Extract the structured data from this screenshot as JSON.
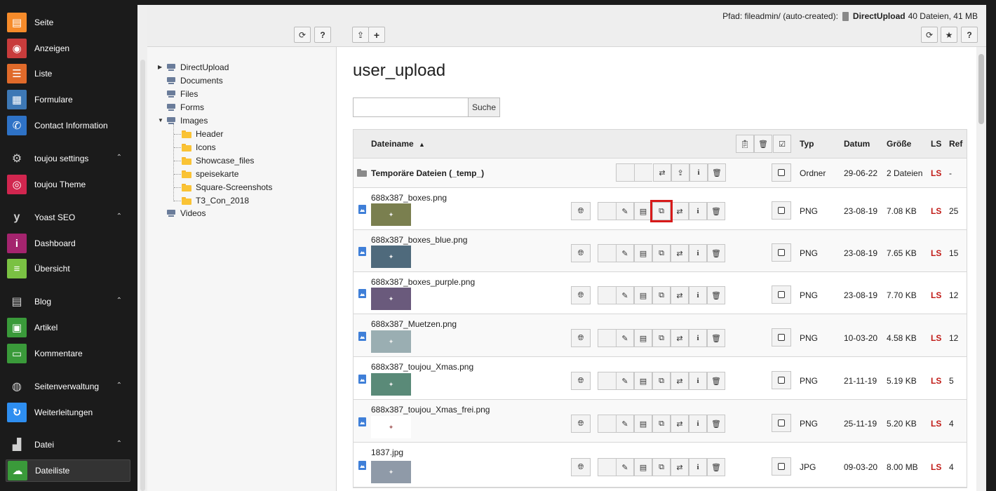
{
  "module_menu": [
    {
      "label": "Seite",
      "icon": "page-icon",
      "glyph": "▤",
      "color": "#f68b2a",
      "group": false
    },
    {
      "label": "Anzeigen",
      "icon": "eye-icon",
      "glyph": "◉",
      "color": "#c83c3c",
      "group": false
    },
    {
      "label": "Liste",
      "icon": "list-icon",
      "glyph": "☰",
      "color": "#e06a2a",
      "group": false
    },
    {
      "label": "Formulare",
      "icon": "form-icon",
      "glyph": "▦",
      "color": "#3d78b5",
      "group": false
    },
    {
      "label": "Contact Information",
      "icon": "contact-icon",
      "glyph": "✆",
      "color": "#2e72c6",
      "group": false
    },
    {
      "label": "toujou settings",
      "icon": "gear-icon",
      "glyph": "⚙",
      "color": "transparent",
      "group": true
    },
    {
      "label": "toujou Theme",
      "icon": "fingerprint-icon",
      "glyph": "◎",
      "color": "#d1264f",
      "group": false
    },
    {
      "label": "Yoast SEO",
      "icon": "yoast-icon",
      "glyph": "y",
      "color": "transparent",
      "group": true
    },
    {
      "label": "Dashboard",
      "icon": "info-icon",
      "glyph": "i",
      "color": "#a4246e",
      "group": false
    },
    {
      "label": "Übersicht",
      "icon": "overview-icon",
      "glyph": "≡",
      "color": "#7ac143",
      "group": false
    },
    {
      "label": "Blog",
      "icon": "blog-icon",
      "glyph": "▤",
      "color": "transparent",
      "group": true
    },
    {
      "label": "Artikel",
      "icon": "article-icon",
      "glyph": "▣",
      "color": "#3a9a3a",
      "group": false
    },
    {
      "label": "Kommentare",
      "icon": "comment-icon",
      "glyph": "▭",
      "color": "#3a9a3a",
      "group": false
    },
    {
      "label": "Seitenverwaltung",
      "icon": "globe-icon",
      "glyph": "◍",
      "color": "transparent",
      "group": true
    },
    {
      "label": "Weiterleitungen",
      "icon": "redirect-icon",
      "glyph": "↻",
      "color": "#2e8ef0",
      "group": false
    },
    {
      "label": "Datei",
      "icon": "file-group-icon",
      "glyph": "▟",
      "color": "transparent",
      "group": true
    },
    {
      "label": "Dateiliste",
      "icon": "filelist-icon",
      "glyph": "☁",
      "color": "#3a9a3a",
      "group": false
    }
  ],
  "path": {
    "prefix": "Pfad: fileadmin/ (auto-created):",
    "storage": "DirectUpload",
    "info": "40 Dateien, 41 MB"
  },
  "tree": {
    "nodes": [
      "DirectUpload",
      "Documents",
      "Files",
      "Forms",
      "Images",
      "Videos"
    ],
    "folders": [
      "Header",
      "Icons",
      "Showcase_files",
      "speisekarte",
      "Square-Screenshots",
      "T3_Con_2018"
    ]
  },
  "page_title": "user_upload",
  "search": {
    "button": "Suche",
    "value": ""
  },
  "table": {
    "headers": {
      "name": "Dateiname",
      "type": "Typ",
      "date": "Datum",
      "size": "Größe",
      "ls": "LS",
      "ref": "Ref"
    },
    "temp_row": {
      "name": "Temporäre Dateien (_temp_)",
      "type": "Ordner",
      "date": "29-06-22",
      "size": "2 Dateien",
      "ls": "LS",
      "ref": "-"
    },
    "files": [
      {
        "name": "688x387_boxes.png",
        "type": "PNG",
        "date": "23-08-19",
        "size": "7.08 KB",
        "ls": "LS",
        "ref": "25",
        "thumb": "#7a7f4f"
      },
      {
        "name": "688x387_boxes_blue.png",
        "type": "PNG",
        "date": "23-08-19",
        "size": "7.65 KB",
        "ls": "LS",
        "ref": "15",
        "thumb": "#4f6a7c"
      },
      {
        "name": "688x387_boxes_purple.png",
        "type": "PNG",
        "date": "23-08-19",
        "size": "7.70 KB",
        "ls": "LS",
        "ref": "12",
        "thumb": "#6a5a7c"
      },
      {
        "name": "688x387_Muetzen.png",
        "type": "PNG",
        "date": "10-03-20",
        "size": "4.58 KB",
        "ls": "LS",
        "ref": "12",
        "thumb": "#9aaeb2"
      },
      {
        "name": "688x387_toujou_Xmas.png",
        "type": "PNG",
        "date": "21-11-19",
        "size": "5.19 KB",
        "ls": "LS",
        "ref": "5",
        "thumb": "#5a8a78"
      },
      {
        "name": "688x387_toujou_Xmas_frei.png",
        "type": "PNG",
        "date": "25-11-19",
        "size": "5.20 KB",
        "ls": "LS",
        "ref": "4",
        "thumb": "#ffffff"
      },
      {
        "name": "1837.jpg",
        "type": "JPG",
        "date": "09-03-20",
        "size": "8.00 MB",
        "ls": "LS",
        "ref": "4",
        "thumb": "#8f9aa8"
      }
    ]
  }
}
